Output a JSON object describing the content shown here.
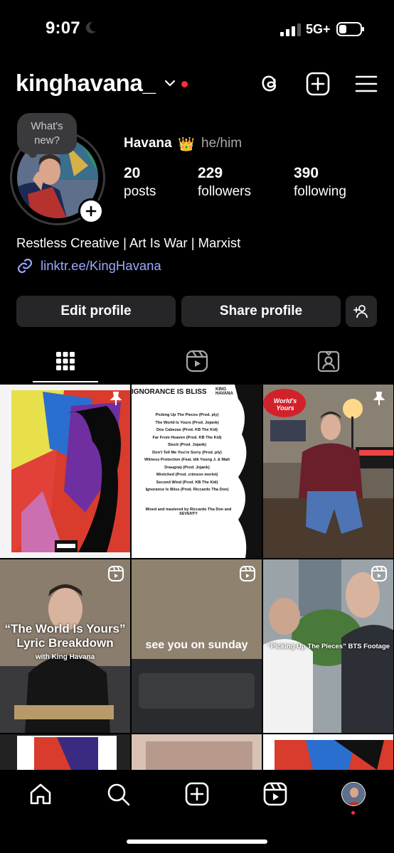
{
  "status": {
    "time": "9:07",
    "network": "5G+"
  },
  "header": {
    "username": "kinghavana_"
  },
  "note": {
    "text": "What's new?"
  },
  "profile": {
    "display_name": "Havana",
    "emoji": "👑",
    "pronouns": "he/him",
    "stats": [
      {
        "value": "20",
        "label": "posts"
      },
      {
        "value": "229",
        "label": "followers"
      },
      {
        "value": "390",
        "label": "following"
      }
    ],
    "bio": "Restless Creative | Art Is War | Marxist",
    "link": "linktr.ee/KingHavana"
  },
  "buttons": {
    "edit": "Edit profile",
    "share": "Share profile"
  },
  "tracklist": {
    "title": "IGNORANCE IS BLISS",
    "artist": "KING HAVANA",
    "tracks": [
      "Picking Up The Pieces (Prod. ply)",
      "The World Is Yours (Prod. Jojank)",
      "Dos Cabezas (Prod. KB The Kid)",
      "Far From Heaven (Prod. KB The Kid)",
      "Stuck (Prod. Jojank)",
      "Don't Tell Me You're Sorry (Prod. ply)",
      "Witness Protection (Feat. Idk Young J. & Matt Draugna) (Prod. Jojank)",
      "Wretched (Prod. crimzon merlot)",
      "Second Wind (Prod. KB The Kid)",
      "Ignorance Is Bliss (Prod. Riccardo Tha Don)"
    ],
    "credits": "Mixed and mastered by Riccardo Tha Don and SEVENTY",
    "advisory": "PARENTAL ADVISORY EXPLICIT CONTENT"
  },
  "posts": {
    "sign_text": "World's Yours",
    "reel1_title": "“The World Is Yours” Lyric Breakdown",
    "reel1_sub": "with King Havana",
    "reel2_caption": "see you on sunday",
    "reel3_caption": "“Picking Up The Pieces” BTS Footage"
  },
  "colors": {
    "accent_link": "#9aa7ff",
    "notification": "#ff2d3b",
    "button_bg": "#262629"
  }
}
